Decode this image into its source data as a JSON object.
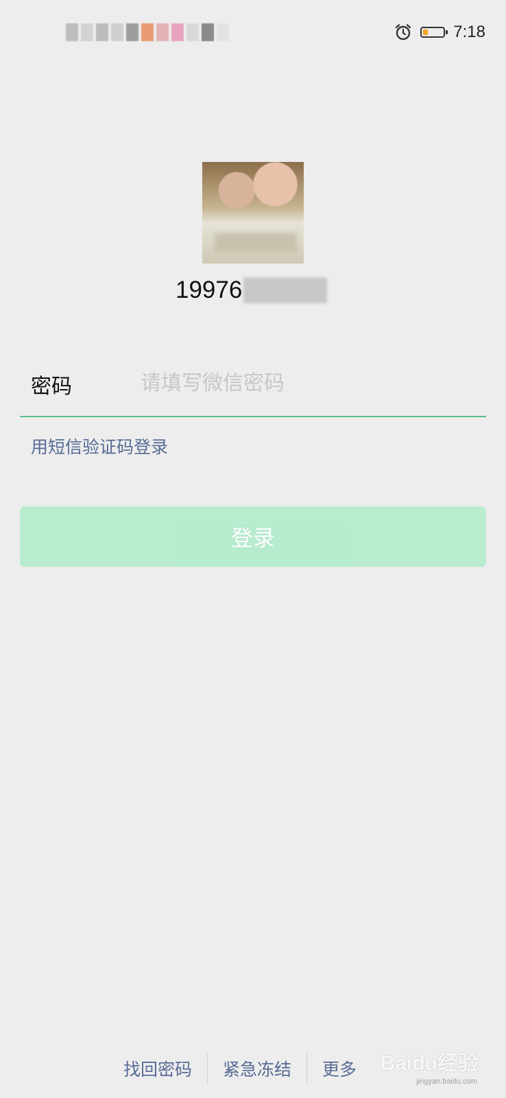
{
  "status_bar": {
    "time": "7:18",
    "icons": [
      "alarm-icon",
      "battery-icon"
    ],
    "battery_level": 0.25,
    "battery_color": "#f5a623"
  },
  "account": {
    "number_prefix": "19976"
  },
  "password": {
    "label": "密码",
    "placeholder": "请填写微信密码",
    "value": ""
  },
  "sms_login_label": "用短信验证码登录",
  "login_button": {
    "label": "登录",
    "color": "#b2ebcb"
  },
  "footer": {
    "links": [
      "找回密码",
      "紧急冻结",
      "更多"
    ]
  },
  "watermark": {
    "text": "Baidu经验",
    "subtext": "jingyan.baidu.com"
  },
  "colors": {
    "background": "#ededed",
    "link": "#576b95",
    "accent": "#57be8a"
  }
}
